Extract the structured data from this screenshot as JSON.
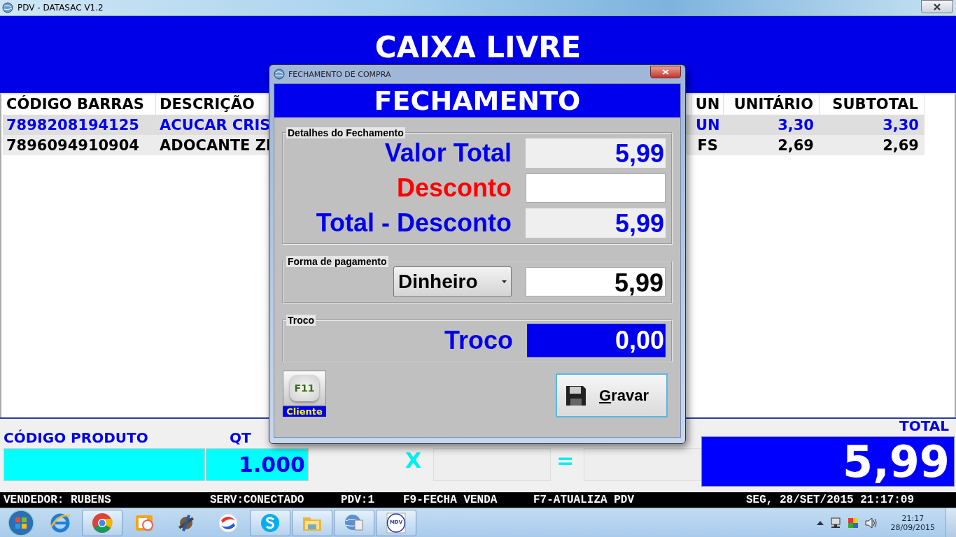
{
  "window": {
    "title": "PDV - DATASAC V1.2"
  },
  "banner": {
    "title": "CAIXA LIVRE"
  },
  "table": {
    "columns": [
      "CÓDIGO BARRAS",
      "DESCRIÇÃO",
      "UN",
      "UNITÁRIO",
      "SUBTOTAL"
    ],
    "rows": [
      {
        "cells": [
          "7898208194125",
          "ACUCAR CRIS",
          "UN",
          "3,30",
          "3,30"
        ],
        "selected": true
      },
      {
        "cells": [
          "7896094910904",
          "ADOCANTE ZI",
          "FS",
          "2,69",
          "2,69"
        ],
        "selected": false
      }
    ]
  },
  "entry": {
    "product_label": "CÓDIGO PRODUTO",
    "qty_label": "QT",
    "qty_value": "1.000",
    "times": "X",
    "equals": "=",
    "total_label": "TOTAL",
    "total_value": "5,99"
  },
  "status_bar": [
    "VENDEDOR: RUBENS",
    "SERV:CONECTADO",
    "PDV:1",
    "F9-FECHA VENDA",
    "F7-ATUALIZA PDV",
    "SEG, 28/SET/2015 21:17:09"
  ],
  "dialog": {
    "title": "FECHAMENTO DE COMPRA",
    "heading": "FECHAMENTO",
    "details": {
      "legend": "Detalhes do Fechamento",
      "rows": [
        {
          "label": "Valor Total",
          "color": "#0000ee",
          "value": "5,99"
        },
        {
          "label": "Desconto",
          "color": "#ff0000"
        },
        {
          "label": "Total - Desconto",
          "color": "#0000ee",
          "value": "5,99"
        }
      ]
    },
    "payment": {
      "legend": "Forma de pagamento",
      "method": "Dinheiro",
      "value": "5,99"
    },
    "change": {
      "legend": "Troco",
      "label": "Troco",
      "value": "0,00"
    },
    "client_button": {
      "key": "F11",
      "label": "Cliente"
    },
    "save_button": {
      "label": "Gravar"
    }
  },
  "taskbar": {
    "items": [
      {
        "kind": "start"
      },
      {
        "kind": "ie",
        "running": false
      },
      {
        "kind": "chrome",
        "running": true
      },
      {
        "kind": "outlook",
        "running": false
      },
      {
        "kind": "tools",
        "running": false
      },
      {
        "kind": "swirl",
        "running": false
      },
      {
        "kind": "skype",
        "running": true
      },
      {
        "kind": "folder",
        "running": true
      },
      {
        "kind": "globe",
        "running": true
      },
      {
        "kind": "mdv",
        "running": true,
        "label": "MDV"
      }
    ],
    "clock": {
      "time": "21:17",
      "date": "28/09/2015"
    }
  }
}
